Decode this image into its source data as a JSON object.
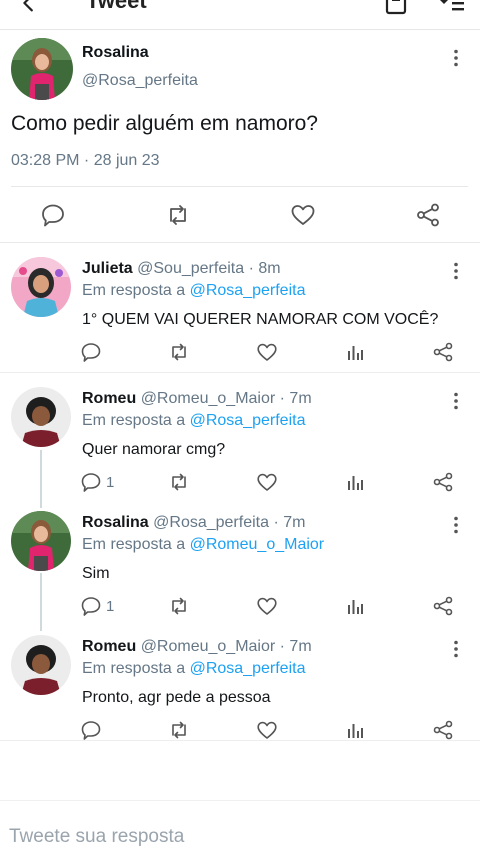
{
  "header": {
    "title": "Tweet"
  },
  "main_tweet": {
    "name": "Rosalina",
    "handle": "@Rosa_perfeita",
    "text": "Como pedir alguém em namoro?",
    "timestamp": "03:28 PM · 28 jun 23"
  },
  "replies": [
    {
      "name": "Julieta",
      "handle": "@Sou_perfeita · 8m",
      "reply_prefix": "Em resposta a",
      "reply_to": "@Rosa_perfeita",
      "text": "1° QUEM VAI QUERER NAMORAR COM VOCÊ?",
      "reply_count": ""
    },
    {
      "name": "Romeu",
      "handle": "@Romeu_o_Maior · 7m",
      "reply_prefix": "Em resposta a",
      "reply_to": "@Rosa_perfeita",
      "text": "Quer namorar cmg?",
      "reply_count": "1"
    },
    {
      "name": "Rosalina",
      "handle": "@Rosa_perfeita · 7m",
      "reply_prefix": "Em resposta a",
      "reply_to": "@Romeu_o_Maior",
      "text": "Sim",
      "reply_count": "1"
    },
    {
      "name": "Romeu",
      "handle": "@Romeu_o_Maior · 7m",
      "reply_prefix": "Em resposta a",
      "reply_to": "@Rosa_perfeita",
      "text": "Pronto, agr pede a pessoa",
      "reply_count": ""
    }
  ],
  "compose": {
    "placeholder": "Tweete sua resposta"
  },
  "colors": {
    "link": "#1da1f2",
    "muted": "#657786",
    "text": "#14171a"
  }
}
